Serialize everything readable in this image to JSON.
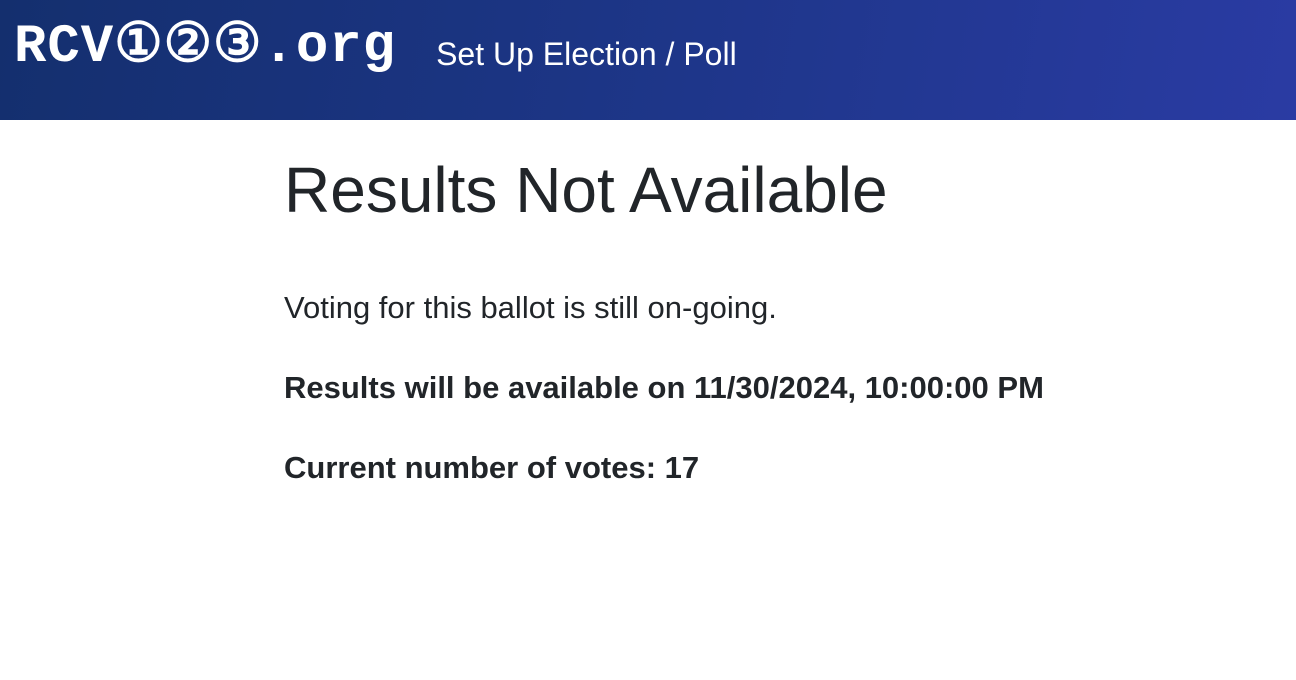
{
  "header": {
    "brand": "RCV①②③.org",
    "nav_link": "Set Up Election / Poll"
  },
  "main": {
    "title": "Results Not Available",
    "message": "Voting for this ballot is still on-going.",
    "availability": "Results will be available on 11/30/2024, 10:00:00 PM",
    "vote_count": "Current number of votes: 17"
  },
  "colors": {
    "header_start": "#142f6e",
    "header_end": "#2a3ba3",
    "text": "#212529"
  }
}
